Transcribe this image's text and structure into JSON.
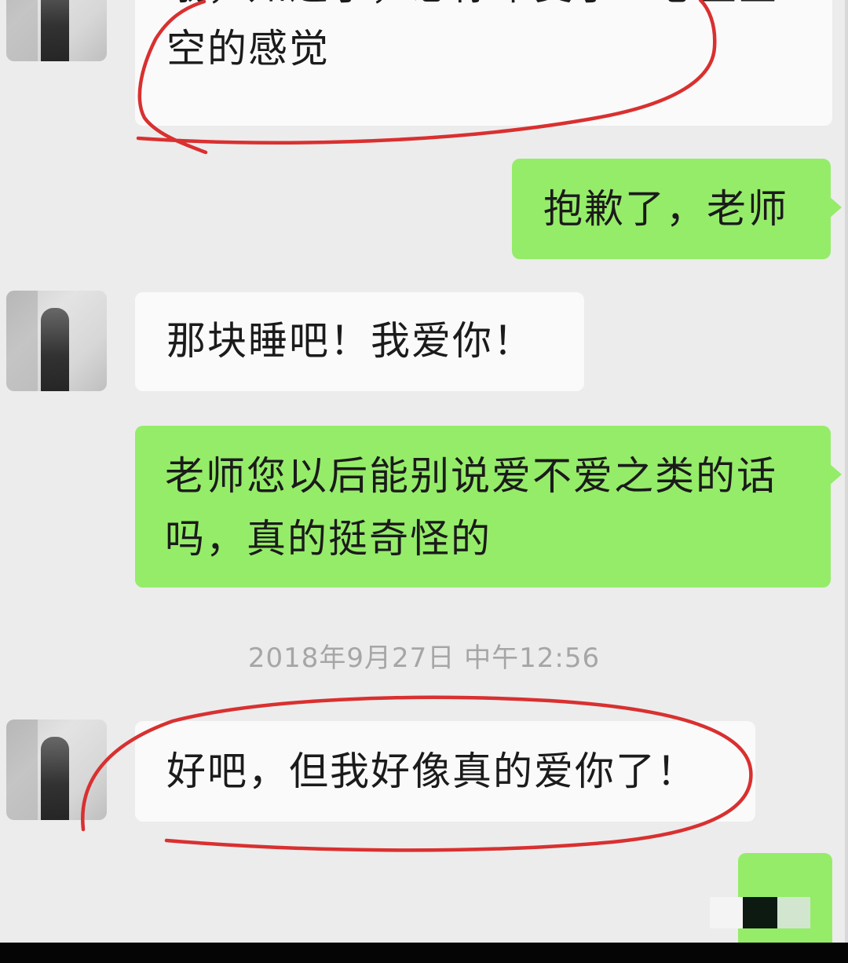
{
  "chat": {
    "messages": [
      {
        "side": "left",
        "line1": "哦，知道了，想你难受了！心里空",
        "line2": "空的感觉"
      },
      {
        "side": "right",
        "line1": "抱歉了，老师"
      },
      {
        "side": "left",
        "line1": "那块睡吧！我爱你！"
      },
      {
        "side": "right",
        "line1": "老师您以后能别说爱不爱之类的话",
        "line2": "吗，真的挺奇怪的"
      },
      {
        "side": "left",
        "line1": "好吧，但我好像真的爱你了！"
      }
    ],
    "timestamp": "2018年9月27日 中午12:56"
  },
  "colors": {
    "chat_background": "#ececec",
    "outgoing_bubble": "#95ec69",
    "incoming_bubble": "#fafafa",
    "annotation_ink": "#d93030",
    "timestamp_text": "#a6a6a6"
  },
  "icons": {
    "avatar": "avatar-photo"
  }
}
